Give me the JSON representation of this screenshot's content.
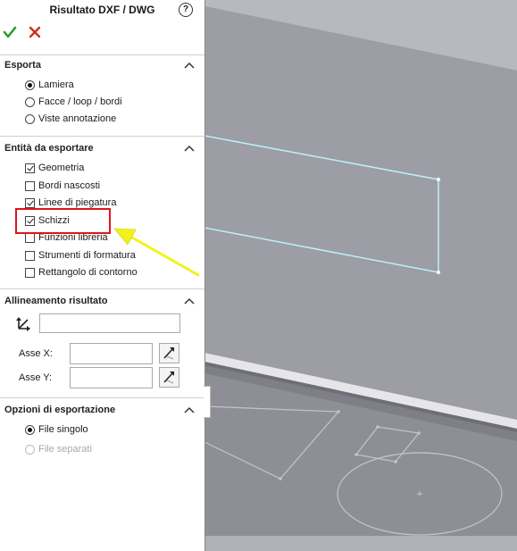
{
  "panel": {
    "title": "Risultato DXF / DWG",
    "help_icon": "?",
    "sections": {
      "export": {
        "title": "Esporta",
        "options": [
          "Lamiera",
          "Facce / loop / bordi",
          "Viste annotazione"
        ],
        "selected": "Lamiera"
      },
      "entities": {
        "title": "Entità da esportare",
        "items": [
          {
            "label": "Geometria",
            "checked": true
          },
          {
            "label": "Bordi nascosti",
            "checked": false
          },
          {
            "label": "Linee di piegatura",
            "checked": true
          },
          {
            "label": "Schizzi",
            "checked": true
          },
          {
            "label": "Funzioni libreria",
            "checked": false
          },
          {
            "label": "Strumenti di formatura",
            "checked": false
          },
          {
            "label": "Rettangolo di contorno",
            "checked": false
          }
        ]
      },
      "alignment": {
        "title": "Allineamento risultato",
        "origin_value": "",
        "axis_x_label": "Asse X:",
        "axis_x_value": "",
        "axis_y_label": "Asse Y:",
        "axis_y_value": ""
      },
      "output": {
        "title": "Opzioni di esportazione",
        "options": [
          {
            "label": "File singolo",
            "selected": true,
            "enabled": true
          },
          {
            "label": "File separati",
            "selected": false,
            "enabled": false
          }
        ]
      }
    }
  },
  "colors": {
    "ok_green": "#2e9b2e",
    "cancel_red": "#d32a1c",
    "highlight_red": "#e0141c",
    "arrow_yellow": "#f2f21a",
    "sketch_cyan": "#bdf0f7",
    "viewport_bg": "#7f8087"
  }
}
